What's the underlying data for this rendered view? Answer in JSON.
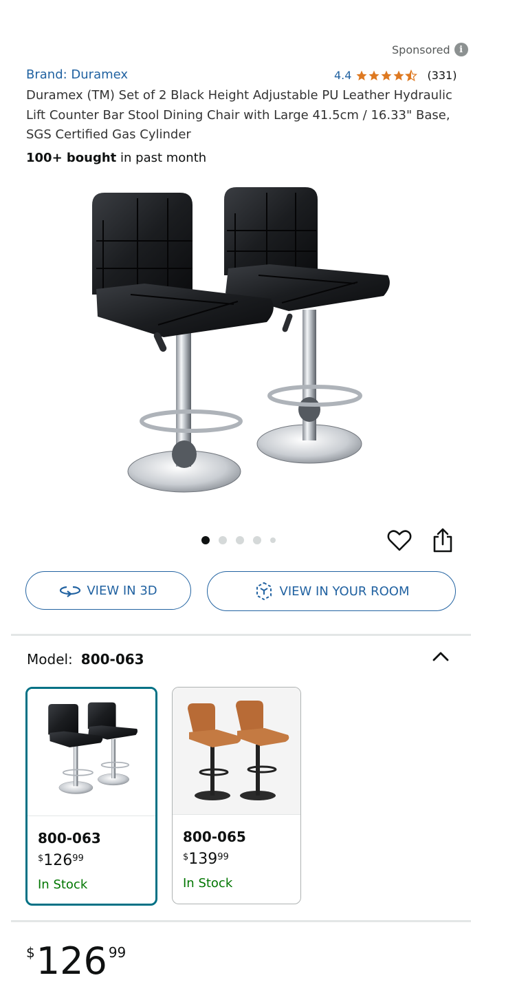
{
  "sponsored": {
    "label": "Sponsored",
    "icon": "info-icon"
  },
  "product": {
    "brand": "Brand: Duramex",
    "rating_value": "4.4",
    "rating_count": "(331)",
    "rating_stars": 4.4,
    "star_color": "#de7921",
    "title": "Duramex (TM) Set of 2 Black Height Adjustable PU Leather Hydraulic Lift Counter Bar Stool Dining Chair with Large 41.5cm / 16.33\" Base, SGS Certified Gas Cylinder",
    "bought_bold": "100+ bought",
    "bought_rest": " in past month"
  },
  "gallery": {
    "image_count": 5,
    "active_index": 0
  },
  "actions": {
    "view_3d": "VIEW IN 3D",
    "view_room": "VIEW IN YOUR ROOM",
    "accent": "#2162a1"
  },
  "model": {
    "label": "Model:",
    "selected": "800-063",
    "options": [
      {
        "name": "800-063",
        "price_symbol": "$",
        "price_whole": "126",
        "price_cents": "99",
        "stock": "In Stock",
        "selected": true,
        "variant": "black-leather"
      },
      {
        "name": "800-065",
        "price_symbol": "$",
        "price_whole": "139",
        "price_cents": "99",
        "stock": "In Stock",
        "selected": false,
        "variant": "tan-suede"
      }
    ]
  },
  "price": {
    "symbol": "$",
    "whole": "126",
    "cents": "99"
  }
}
